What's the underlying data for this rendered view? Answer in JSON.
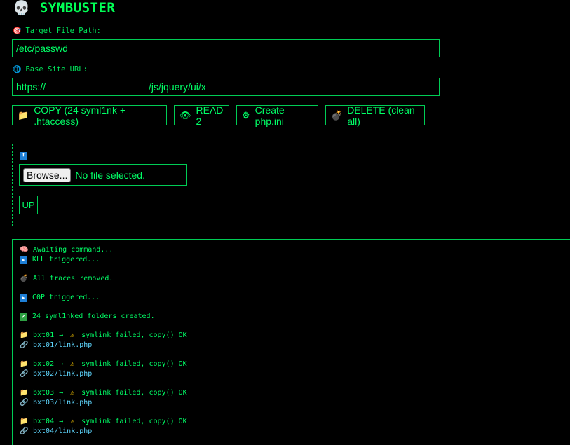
{
  "header": {
    "icon": "skull-icon",
    "title": "SYMBUSTER"
  },
  "target": {
    "icon": "target-icon",
    "label": "Target File Path:",
    "value": "/etc/passwd"
  },
  "base": {
    "icon": "globe-icon",
    "label": "Base Site URL:",
    "value_prefix": "https://",
    "value_suffix": "/js/jquery/ui/x"
  },
  "buttons": {
    "copy": {
      "icon": "folder-icon",
      "label": "COPY (24 syml1nk + .htaccess)"
    },
    "read": {
      "icon": "eye-icon",
      "label": "READ 2"
    },
    "phpini": {
      "icon": "gear-icon",
      "label": "Create php.ini"
    },
    "delete": {
      "icon": "bomb-icon",
      "label": "DELETE (clean all)"
    }
  },
  "upload": {
    "icon": "upload-icon",
    "browse_label": "Browse...",
    "file_status": "No file selected.",
    "up_label": "UP"
  },
  "console": {
    "awaiting": "Awaiting command...",
    "kll": "KLL triggered...",
    "traces": "All traces removed.",
    "c0p": "C0P triggered...",
    "created": "24 syml1nked folders created.",
    "entries": [
      {
        "folder": "bxt01",
        "arrow": "→",
        "status": "symlink failed, copy() OK",
        "link": "bxt01/link.php"
      },
      {
        "folder": "bxt02",
        "arrow": "→",
        "status": "symlink failed, copy() OK",
        "link": "bxt02/link.php"
      },
      {
        "folder": "bxt03",
        "arrow": "→",
        "status": "symlink failed, copy() OK",
        "link": "bxt03/link.php"
      },
      {
        "folder": "bxt04",
        "arrow": "→",
        "status": "symlink failed, copy() OK",
        "link": "bxt04/link.php"
      }
    ]
  },
  "colors": {
    "background": "#000000",
    "text": "#00ff66",
    "border": "#00cc55",
    "link": "#5fd7ff",
    "warning": "#ffcc00"
  }
}
